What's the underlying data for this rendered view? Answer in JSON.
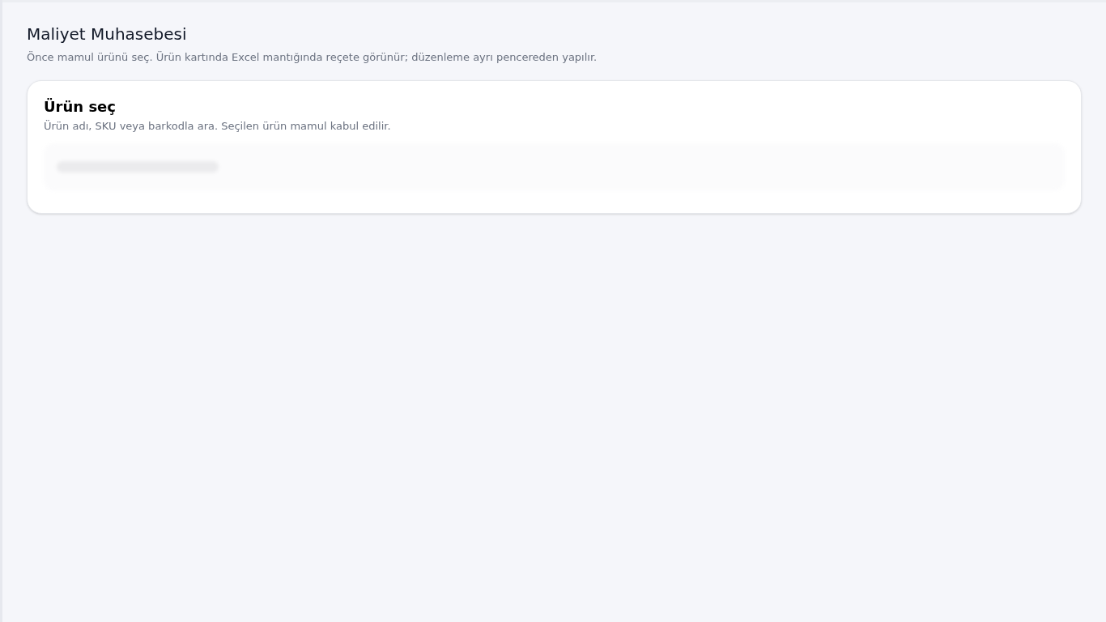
{
  "page": {
    "title": "Maliyet Muhasebesi",
    "subtitle": "Önce mamul ürünü seç. Ürün kartında Excel mantığında reçete görünür; düzenleme ayrı pencereden yapılır."
  },
  "product_picker": {
    "title": "Ürün seç",
    "hint": "Ürün adı, SKU veya barkodla ara. Seçilen ürün mamul kabul edilir.",
    "loading": true
  }
}
